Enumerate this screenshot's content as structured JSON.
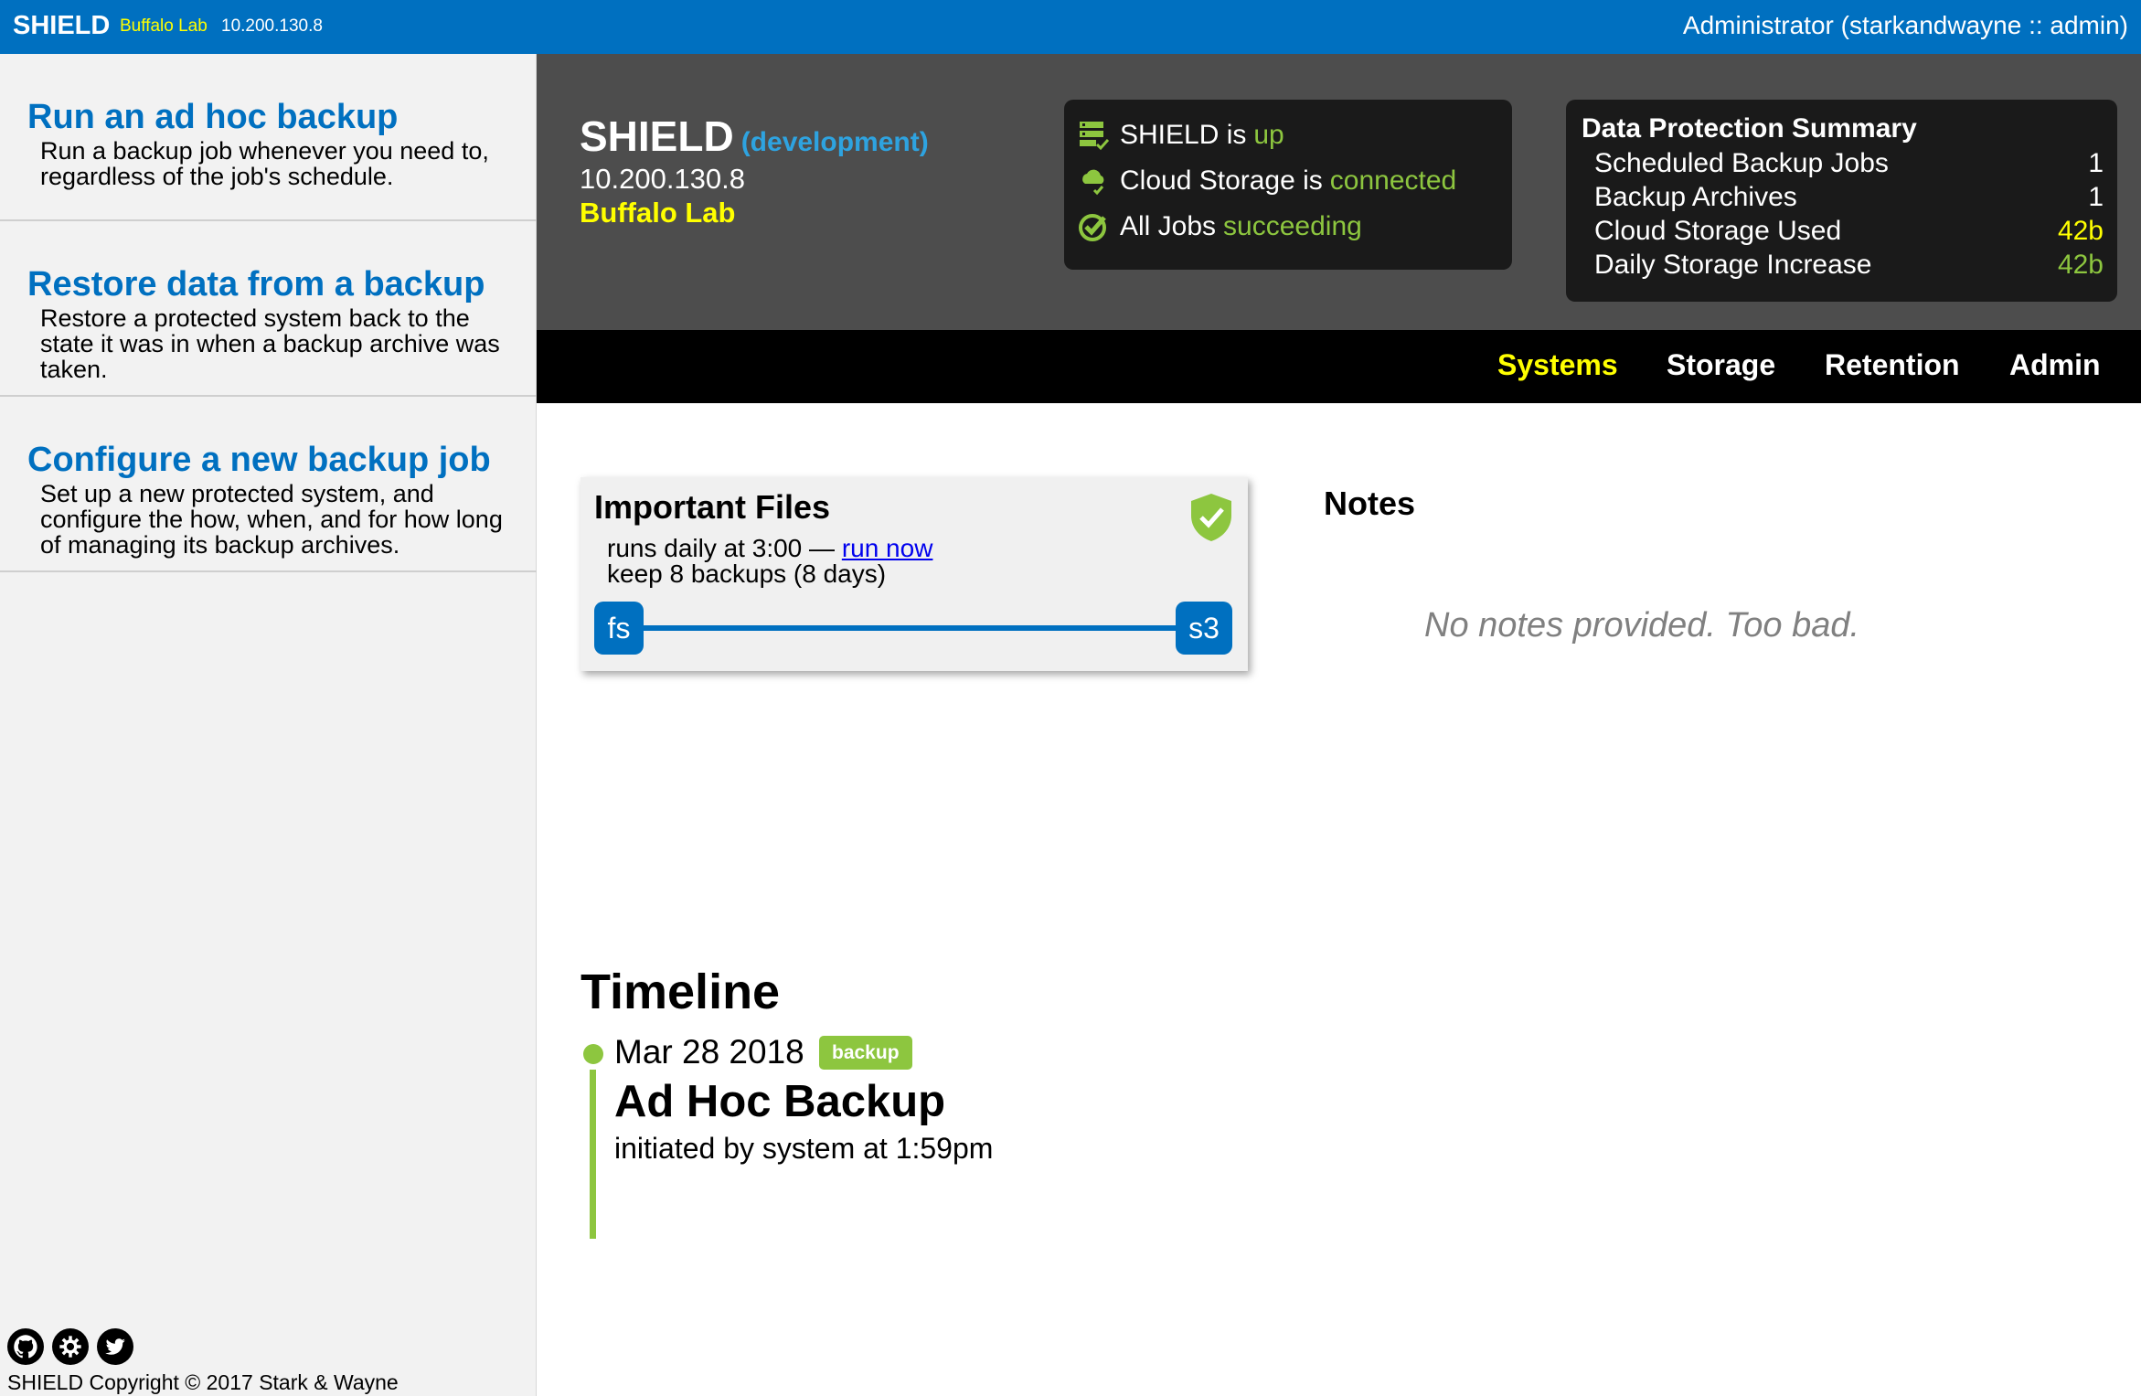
{
  "topbar": {
    "brand": "SHIELD",
    "environment": "Buffalo Lab",
    "ip": "10.200.130.8",
    "user": "Administrator (starkandwayne :: admin)"
  },
  "sidebar": {
    "items": [
      {
        "title": "Run an ad hoc backup",
        "description": "Run a backup job whenever you need to, regardless of the job's schedule."
      },
      {
        "title": "Restore data from a backup",
        "description": "Restore a protected system back to the state it was in when a backup archive was taken."
      },
      {
        "title": "Configure a new backup job",
        "description": "Set up a new protected system, and configure the how, when, and for how long of managing its backup archives."
      }
    ],
    "footer_icons": [
      "github-icon",
      "settings-gear-icon",
      "twitter-icon"
    ],
    "copyright": "SHIELD Copyright © 2017 Stark & Wayne"
  },
  "header": {
    "name": "SHIELD",
    "env": "(development)",
    "ip": "10.200.130.8",
    "lab": "Buffalo Lab",
    "status": [
      {
        "icon": "server-check-icon",
        "label": "SHIELD is",
        "value": "up"
      },
      {
        "icon": "cloud-check-icon",
        "label": "Cloud Storage is",
        "value": "connected"
      },
      {
        "icon": "check-circle-icon",
        "label": "All Jobs",
        "value": "succeeding"
      }
    ],
    "summary": {
      "title": "Data Protection Summary",
      "rows": [
        {
          "label": "Scheduled Backup Jobs",
          "value": "1",
          "color": "#ffffff"
        },
        {
          "label": "Backup Archives",
          "value": "1",
          "color": "#ffffff"
        },
        {
          "label": "Cloud Storage Used",
          "value": "42b",
          "color": "#ffff00"
        },
        {
          "label": "Daily Storage Increase",
          "value": "42b",
          "color": "#8dc63f"
        }
      ]
    }
  },
  "nav": {
    "tabs": [
      "Systems",
      "Storage",
      "Retention",
      "Admin"
    ],
    "active": "Systems"
  },
  "job": {
    "title": "Important Files",
    "schedule_prefix": "runs daily at 3:00 —",
    "run_now": "run now",
    "keep": "keep 8 backups (8 days)",
    "source": "fs",
    "target": "s3",
    "status_icon": "shield-check-icon"
  },
  "notes": {
    "title": "Notes",
    "empty": "No notes provided. Too bad."
  },
  "timeline": {
    "title": "Timeline",
    "entries": [
      {
        "date": "Mar 28 2018",
        "badge": "backup",
        "title": "Ad Hoc Backup",
        "subtitle": "initiated by system at 1:59pm"
      }
    ]
  },
  "colors": {
    "brand_blue": "#0070c0",
    "accent_yellow": "#ffff00",
    "success_green": "#8dc63f",
    "env_blue": "#2ea3e0"
  }
}
